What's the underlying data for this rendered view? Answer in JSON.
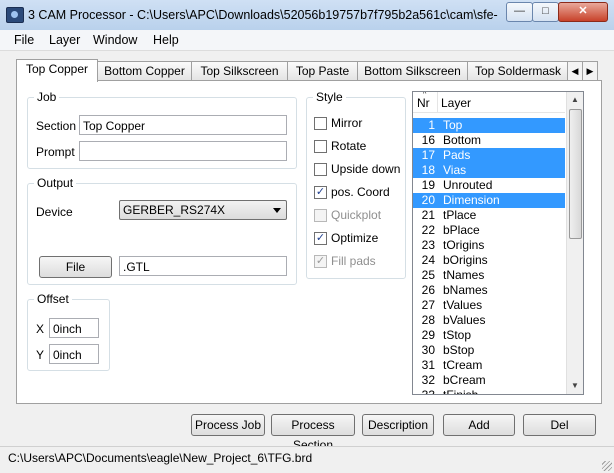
{
  "window": {
    "title": "3 CAM Processor - C:\\Users\\APC\\Downloads\\52056b19757b7f795b2a561c\\cam\\sfe-ger...",
    "min_glyph": "—",
    "max_glyph": "□",
    "close_glyph": "✕"
  },
  "menu": [
    "File",
    "Layer",
    "Window",
    "Help"
  ],
  "tabs": [
    "Top Copper",
    "Bottom Copper",
    "Top Silkscreen",
    "Top Paste",
    "Bottom Silkscreen",
    "Top Soldermask"
  ],
  "tab_scroll": {
    "left": "◀",
    "right": "▶"
  },
  "active_tab": 0,
  "job": {
    "group_label": "Job",
    "section_label": "Section",
    "section_value": "Top Copper",
    "prompt_label": "Prompt",
    "prompt_value": ""
  },
  "output": {
    "group_label": "Output",
    "device_label": "Device",
    "device_value": "GERBER_RS274X",
    "file_button": "File",
    "file_value": ".GTL"
  },
  "offset": {
    "group_label": "Offset",
    "x_label": "X",
    "x_value": "0inch",
    "y_label": "Y",
    "y_value": "0inch"
  },
  "style": {
    "group_label": "Style",
    "options": [
      {
        "label": "Mirror",
        "checked": false,
        "enabled": true
      },
      {
        "label": "Rotate",
        "checked": false,
        "enabled": true
      },
      {
        "label": "Upside down",
        "checked": false,
        "enabled": true
      },
      {
        "label": "pos. Coord",
        "checked": true,
        "enabled": true
      },
      {
        "label": "Quickplot",
        "checked": false,
        "enabled": false
      },
      {
        "label": "Optimize",
        "checked": true,
        "enabled": true
      },
      {
        "label": "Fill pads",
        "checked": true,
        "enabled": false
      }
    ]
  },
  "layers": {
    "col_nr": "Nr",
    "col_layer": "Layer",
    "rows": [
      {
        "nr": "1",
        "name": "Top",
        "selected": true
      },
      {
        "nr": "16",
        "name": "Bottom",
        "selected": false
      },
      {
        "nr": "17",
        "name": "Pads",
        "selected": true
      },
      {
        "nr": "18",
        "name": "Vias",
        "selected": true
      },
      {
        "nr": "19",
        "name": "Unrouted",
        "selected": false
      },
      {
        "nr": "20",
        "name": "Dimension",
        "selected": true
      },
      {
        "nr": "21",
        "name": "tPlace",
        "selected": false
      },
      {
        "nr": "22",
        "name": "bPlace",
        "selected": false
      },
      {
        "nr": "23",
        "name": "tOrigins",
        "selected": false
      },
      {
        "nr": "24",
        "name": "bOrigins",
        "selected": false
      },
      {
        "nr": "25",
        "name": "tNames",
        "selected": false
      },
      {
        "nr": "26",
        "name": "bNames",
        "selected": false
      },
      {
        "nr": "27",
        "name": "tValues",
        "selected": false
      },
      {
        "nr": "28",
        "name": "bValues",
        "selected": false
      },
      {
        "nr": "29",
        "name": "tStop",
        "selected": false
      },
      {
        "nr": "30",
        "name": "bStop",
        "selected": false
      },
      {
        "nr": "31",
        "name": "tCream",
        "selected": false
      },
      {
        "nr": "32",
        "name": "bCream",
        "selected": false
      },
      {
        "nr": "33",
        "name": "tFinish",
        "selected": false
      }
    ]
  },
  "buttons": {
    "process_job": "Process Job",
    "process_section": "Process Section",
    "description": "Description",
    "add": "Add",
    "del": "Del"
  },
  "status": "C:\\Users\\APC\\Documents\\eagle\\New_Project_6\\TFG.brd",
  "colors": {
    "selection": "#3399ff",
    "title_bar": "#b9d1ec",
    "close_button": "#c8422a"
  }
}
